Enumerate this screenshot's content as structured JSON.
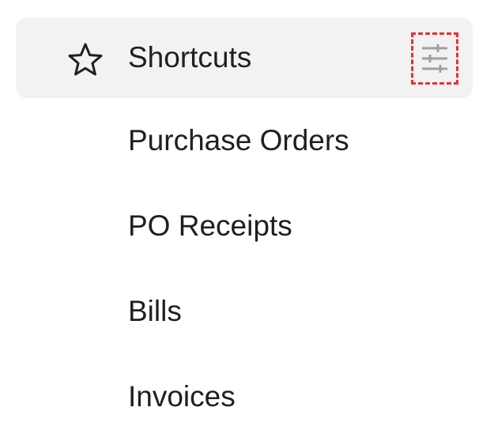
{
  "header": {
    "label": "Shortcuts",
    "icon": "star-outline-icon",
    "action_icon": "sliders-icon"
  },
  "shortcuts": [
    {
      "label": "Purchase Orders"
    },
    {
      "label": "PO Receipts"
    },
    {
      "label": "Bills"
    },
    {
      "label": "Invoices"
    }
  ],
  "colors": {
    "header_background": "#f2f2f2",
    "text": "#1f1f1f",
    "icon_gray": "#a0a0a0",
    "highlight_border": "#e8312f"
  }
}
